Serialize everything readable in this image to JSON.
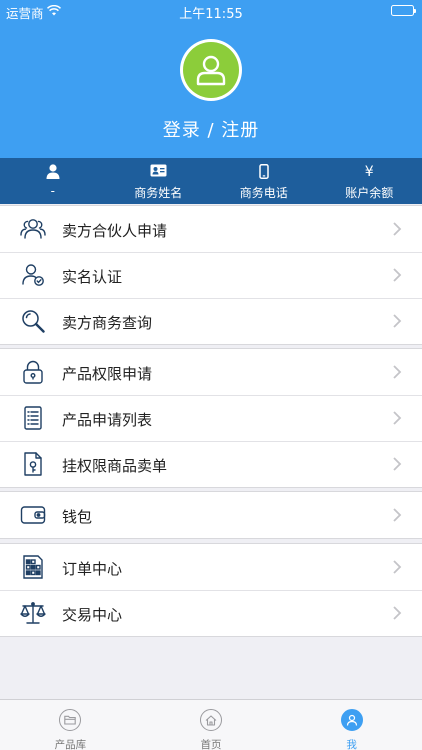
{
  "status_bar": {
    "carrier": "运营商",
    "time": "上午11:55"
  },
  "profile": {
    "login_label": "登录 / 注册"
  },
  "info_bar": [
    {
      "icon": "person-icon",
      "label": "-"
    },
    {
      "icon": "id-card-icon",
      "label": "商务姓名"
    },
    {
      "icon": "phone-icon",
      "label": "商务电话"
    },
    {
      "icon": "yen-icon",
      "glyph": "¥",
      "label": "账户余额"
    }
  ],
  "menu_groups": [
    {
      "items": [
        {
          "icon": "partners-icon",
          "label": "卖方合伙人申请"
        },
        {
          "icon": "user-verified-icon",
          "label": "实名认证"
        },
        {
          "icon": "search-icon",
          "label": "卖方商务查询"
        }
      ]
    },
    {
      "items": [
        {
          "icon": "lock-icon",
          "label": "产品权限申请"
        },
        {
          "icon": "document-list-icon",
          "label": "产品申请列表"
        },
        {
          "icon": "document-key-icon",
          "label": "挂权限商品卖单"
        }
      ]
    },
    {
      "items": [
        {
          "icon": "wallet-icon",
          "label": "钱包"
        }
      ]
    },
    {
      "items": [
        {
          "icon": "order-grid-icon",
          "label": "订单中心"
        },
        {
          "icon": "scale-icon",
          "label": "交易中心"
        }
      ]
    }
  ],
  "tab_bar": [
    {
      "icon": "folder-icon",
      "label": "产品库",
      "active": false
    },
    {
      "icon": "home-icon",
      "label": "首页",
      "active": false
    },
    {
      "icon": "user-icon",
      "label": "我",
      "active": true
    }
  ],
  "colors": {
    "header_blue": "#3e9ff2",
    "infobar_blue": "#1e5e9c",
    "avatar_green": "#8ccd3a",
    "icon_navy": "#1f3f63"
  }
}
